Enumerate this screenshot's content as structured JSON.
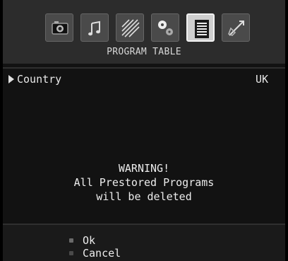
{
  "menu": {
    "icons": [
      {
        "name": "picture-icon",
        "active": false
      },
      {
        "name": "sound-icon",
        "active": false
      },
      {
        "name": "settings-icon",
        "active": false
      },
      {
        "name": "feature-icon",
        "active": false
      },
      {
        "name": "program-table-icon",
        "active": true
      },
      {
        "name": "install-icon",
        "active": false
      }
    ],
    "title": "PROGRAM TABLE"
  },
  "country": {
    "label": "Country",
    "value": "UK"
  },
  "warning": {
    "line1": "WARNING!",
    "line2": "All Prestored Programs",
    "line3": "will be deleted"
  },
  "options": {
    "ok_label": "Ok",
    "cancel_label": "Cancel"
  }
}
